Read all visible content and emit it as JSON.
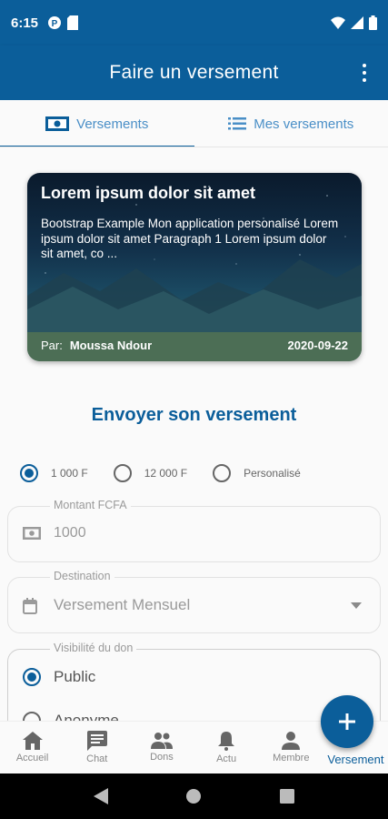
{
  "status": {
    "time": "6:15"
  },
  "appbar": {
    "title": "Faire un versement"
  },
  "tabs": [
    {
      "label": "Versements",
      "icon": "money-icon",
      "active": true
    },
    {
      "label": "Mes versements",
      "icon": "list-icon",
      "active": false
    }
  ],
  "card": {
    "title": "Lorem ipsum dolor sit amet",
    "body": "Bootstrap Example                Mon application personalisé    Lorem ipsum dolor sit amet                Paragraph 1         Lorem ipsum dolor sit amet, co ...",
    "by_label": "Par:",
    "author": "Moussa Ndour",
    "date": "2020-09-22"
  },
  "section_title": "Envoyer son versement",
  "amount_options": [
    {
      "label": "1 000 F",
      "selected": true
    },
    {
      "label": "12 000 F",
      "selected": false
    },
    {
      "label": "Personalisé",
      "selected": false
    }
  ],
  "montant": {
    "label": "Montant FCFA",
    "value": "1000"
  },
  "destination": {
    "label": "Destination",
    "value": "Versement Mensuel"
  },
  "visibility": {
    "label": "Visibilité du don",
    "options": [
      {
        "label": "Public",
        "selected": true
      },
      {
        "label": "Anonyme",
        "selected": false
      }
    ]
  },
  "bottom_nav": [
    {
      "label": "Accueil",
      "icon": "home-icon"
    },
    {
      "label": "Chat",
      "icon": "chat-icon"
    },
    {
      "label": "Dons",
      "icon": "people-icon"
    },
    {
      "label": "Actu",
      "icon": "bell-icon"
    },
    {
      "label": "Membre",
      "icon": "person-icon"
    },
    {
      "label": "Versement",
      "icon": "",
      "active": true
    }
  ],
  "colors": {
    "primary": "#0b5e9a",
    "tab_text": "#4a8fc7"
  }
}
